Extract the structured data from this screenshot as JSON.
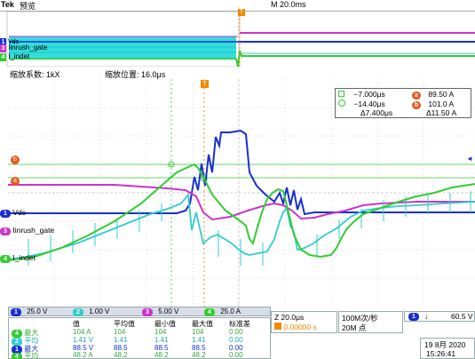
{
  "header": {
    "brand": "Tek",
    "mode": "预览",
    "timebase": "M 20.0ms"
  },
  "zoom": {
    "factor": "缩放系数: 1kX",
    "position": "缩放位置: 16.0μs"
  },
  "channels": [
    {
      "id": "1",
      "label": "Vds",
      "color": "#1a2fd0"
    },
    {
      "id": "3",
      "label": "Iinrush_gate",
      "color": "#cc33cc"
    },
    {
      "id": "4",
      "label": "I_indet",
      "color": "#33cc33"
    },
    {
      "id": "2",
      "label": "",
      "color": "#33cccc"
    }
  ],
  "overview_labels": {
    "vds": "Vds",
    "inrush": "Iinrush_gate",
    "indet": "I_indet"
  },
  "refs": {
    "a": "a",
    "b": "b",
    "T": "T"
  },
  "cursors": {
    "t1": "−7.000μs",
    "t2": "−14.40μs",
    "dt": "Δ7.400μs",
    "va": "89.50 A",
    "vb": "101.0 A",
    "dv": "Δ11.50 A",
    "la": "a",
    "lb": "b"
  },
  "channel_scales": [
    {
      "ch": "1",
      "value": "25.0 V",
      "color": "#1a2fd0"
    },
    {
      "ch": "2",
      "value": "1.00 V",
      "color": "#33cccc"
    },
    {
      "ch": "3",
      "value": "5.00 V",
      "color": "#cc33cc"
    },
    {
      "ch": "4",
      "value": "25.0 A",
      "color": "#33cc33"
    }
  ],
  "stats": {
    "headers": [
      "值",
      "平均值",
      "最小值",
      "最大值",
      "标准差"
    ],
    "rows": [
      {
        "ch": "4",
        "color": "#33cc33",
        "name": "最大",
        "cells": [
          "104 A",
          "104",
          "104",
          "104",
          "0.00"
        ]
      },
      {
        "ch": "2",
        "color": "#33cccc",
        "name": "平均",
        "cells": [
          "1.41 V",
          "1.41",
          "1.41",
          "1.41",
          "0.00"
        ]
      },
      {
        "ch": "1",
        "color": "#1a2fd0",
        "name": "最大",
        "cells": [
          "88.5 V",
          "88.5",
          "88.5",
          "88.5",
          "0.00"
        ]
      },
      {
        "ch": "4",
        "color": "#33cc33",
        "name": "平均",
        "cells": [
          "48.2 A",
          "48.2",
          "48.2",
          "48.2",
          "0.00"
        ]
      }
    ]
  },
  "time": {
    "zoom": "Z 20.0μs",
    "offset": "0.00000 s"
  },
  "acq": {
    "rate": "100M次/秒",
    "points": "20M 点"
  },
  "trigger": {
    "channel": "1",
    "slope": "↓",
    "level": "60.5 V"
  },
  "date": {
    "date": "19 8月 2020",
    "time": "15:26:41"
  }
}
